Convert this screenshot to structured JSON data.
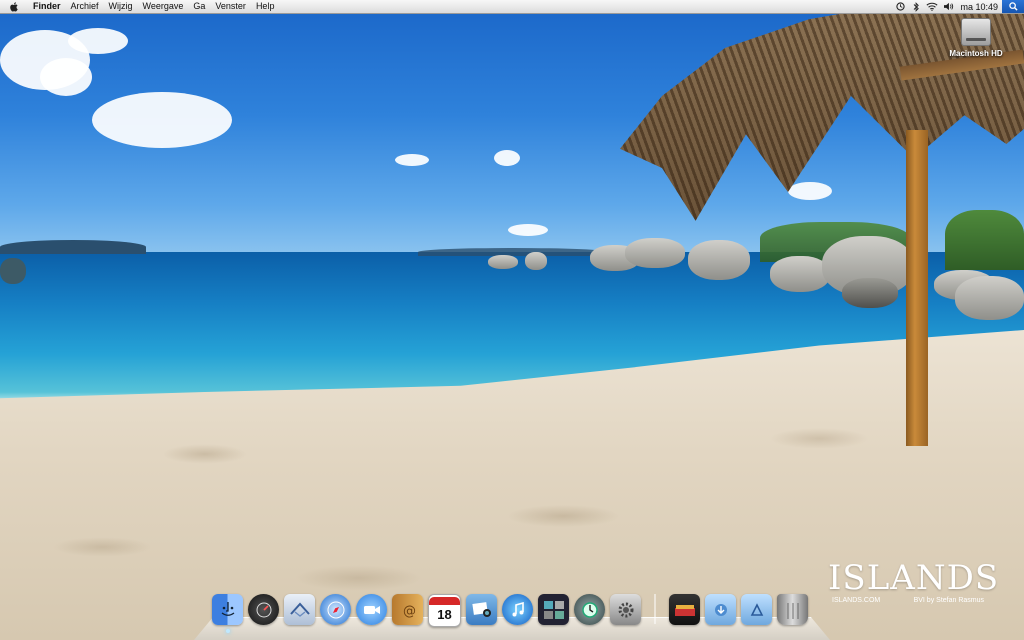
{
  "menubar": {
    "apple_icon": "apple-icon",
    "items": [
      "Finder",
      "Archief",
      "Wijzig",
      "Weergave",
      "Ga",
      "Venster",
      "Help"
    ],
    "status_icons": [
      "time-machine-icon",
      "bluetooth-icon",
      "wifi-icon",
      "volume-icon"
    ],
    "clock": "ma 10:49",
    "spotlight_icon": "spotlight-icon"
  },
  "desktop": {
    "drive_label": "Macintosh HD"
  },
  "wallpaper": {
    "brand_title": "ISLANDS",
    "brand_left": "ISLANDS.COM",
    "brand_right": "BVI by Stefan Rasmus"
  },
  "dock": {
    "apps": [
      {
        "name": "finder-icon",
        "running": true
      },
      {
        "name": "dashboard-icon",
        "running": false
      },
      {
        "name": "mail-icon",
        "running": false
      },
      {
        "name": "safari-icon",
        "running": false
      },
      {
        "name": "ichat-icon",
        "running": false
      },
      {
        "name": "address-book-icon",
        "running": false
      },
      {
        "name": "ical-icon",
        "running": false,
        "badge": "18"
      },
      {
        "name": "iphoto-icon",
        "running": false
      },
      {
        "name": "itunes-icon",
        "running": false
      },
      {
        "name": "spaces-icon",
        "running": false
      },
      {
        "name": "time-machine-icon",
        "running": false
      },
      {
        "name": "system-preferences-icon",
        "running": false
      }
    ],
    "stacks": [
      "documents-stack-icon",
      "downloads-stack-icon",
      "applications-stack-icon",
      "trash-icon"
    ]
  }
}
